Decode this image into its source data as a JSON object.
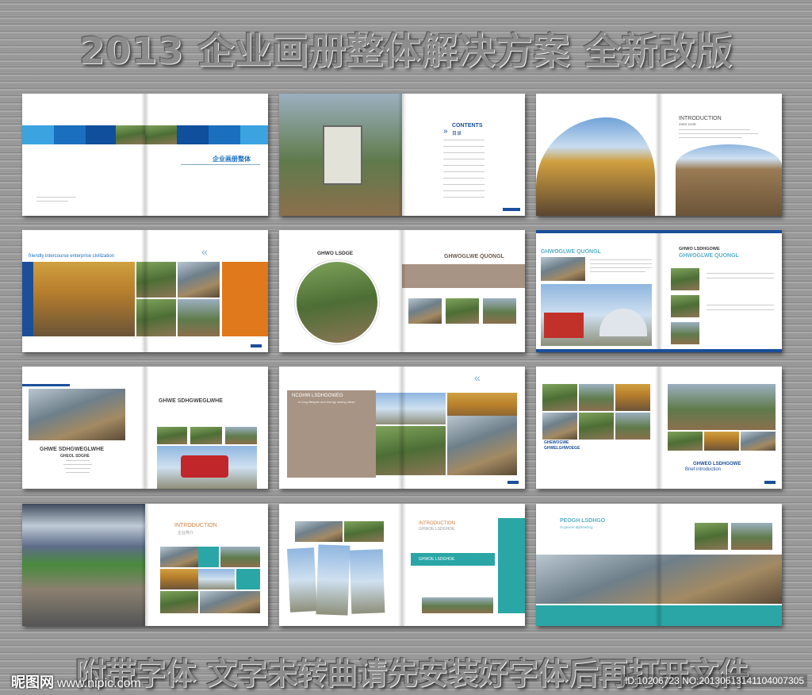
{
  "header": {
    "title": "2013 企业画册整体解决方案  全新改版"
  },
  "footer": {
    "note": "附带字体 文字未转曲请先安装好字体后再打开文件",
    "watermark_logo": "昵图网",
    "watermark_url": "www.nipic.com",
    "image_id": "ID:10206723 NO:20130613141104007305"
  },
  "spreads": {
    "s1": {
      "cover_title": "企业画册整体"
    },
    "s2": {
      "contents_en": "CONTENTS",
      "contents_cn": "目录",
      "arrow": "»"
    },
    "s3": {
      "heading": "INTRODUCTION",
      "sub": "ZHEE DOIR"
    },
    "s4": {
      "slogan": "friendly intercourse  enterprise civilization",
      "arrows": "«"
    },
    "s5": {
      "left_heading": "GHWO LSDGE",
      "right_heading": "GHWOGLWE QUONGL"
    },
    "s6": {
      "left_heading": "GHWOGLWE QUONGL",
      "right_small": "GHWO LSDHGOWE",
      "right_heading": "GHWOGLWE QUONGL"
    },
    "s7": {
      "left_heading": "GHWE SDHGWEGLWHE",
      "left_sub": "GHEOL SDGHE",
      "right_heading": "GHWE SDHGWEGLWHE"
    },
    "s8": {
      "heading": "NCGHW LSDHGOWEG",
      "sub": "to long lifespan and energy saving ideas",
      "arrows": "«"
    },
    "s9": {
      "left_h1": "GHEWOGWE",
      "left_h2": "GHWELGHWOEGE",
      "right_heading": "GHWEO LSDHGOWE",
      "right_sub": "Brief introduction"
    },
    "s10": {
      "heading": "INTRODUCTION",
      "sub": "企业简介"
    },
    "s11": {
      "heading": "INTRODUCTION",
      "sub": "GHWOE LSDGHOE",
      "banner": "GHWOE LSDGHOE"
    },
    "s12": {
      "heading": "PEOGH LSDHGO",
      "sub": "Xcgewne dtjhtewhng"
    }
  }
}
